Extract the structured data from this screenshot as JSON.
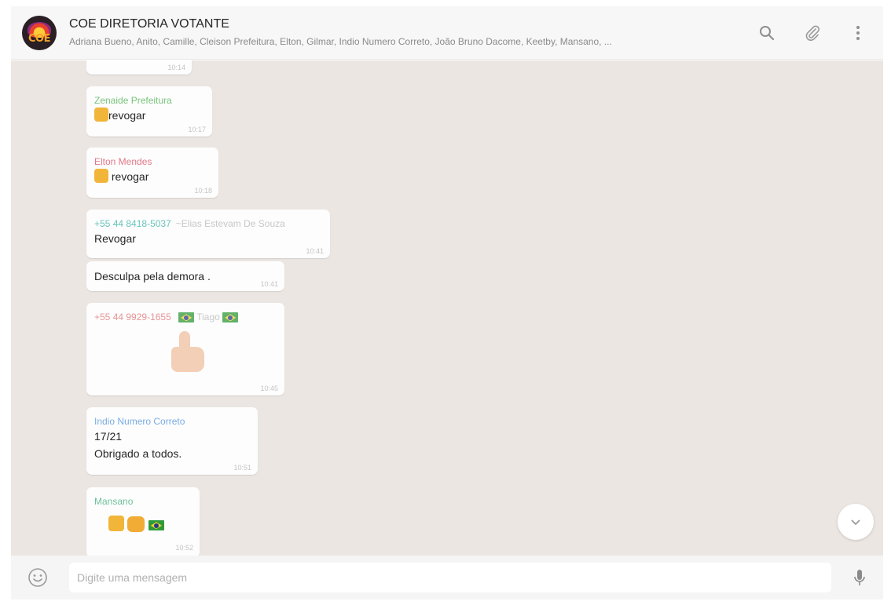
{
  "header": {
    "avatar_text": "COE",
    "title": "COE DIRETORIA VOTANTE",
    "members": "Adriana Bueno, Anito, Camille, Cleison Prefeitura, Elton, Gilmar, Indio Numero Correto, João Bruno Dacome, Keetby, Mansano, ..."
  },
  "messages": [
    {
      "id": "m0",
      "sender": "",
      "alias": "",
      "text": "",
      "time": "10:14"
    },
    {
      "id": "m1",
      "sender": "Zenaide Prefeitura",
      "sender_color": "#4caf50",
      "text": "revogar",
      "time": "10:17"
    },
    {
      "id": "m2",
      "sender": "Elton Mendes",
      "sender_color": "#d84a5f",
      "text": "revogar",
      "time": "10:18"
    },
    {
      "id": "m3",
      "sender": "+55 44 8418-5037",
      "sender_color": "#35b0a6",
      "alias": "~Elias Estevam De Souza",
      "text": "Revogar",
      "time": "10:41"
    },
    {
      "id": "m4",
      "text": "Desculpa pela demora .",
      "time": "10:41"
    },
    {
      "id": "m5",
      "sender": "+55 44 9929-1655",
      "sender_color": "#e07070",
      "alias": "Tiago",
      "time": "10:45"
    },
    {
      "id": "m6",
      "sender": "Indio Numero Correto",
      "sender_color": "#4a90d9",
      "line1": "17/21",
      "line2": "Obrigado a todos.",
      "time": "10:51"
    },
    {
      "id": "m7",
      "sender": "Mansano",
      "sender_color": "#3fae7a",
      "time": "10:52"
    }
  ],
  "composer": {
    "placeholder": "Digite uma mensagem"
  },
  "icons": {
    "search": "search-icon",
    "attach": "paperclip-icon",
    "menu": "more-vertical-icon",
    "emoji": "smiley-icon",
    "mic": "microphone-icon",
    "scroll": "chevron-down-icon"
  }
}
